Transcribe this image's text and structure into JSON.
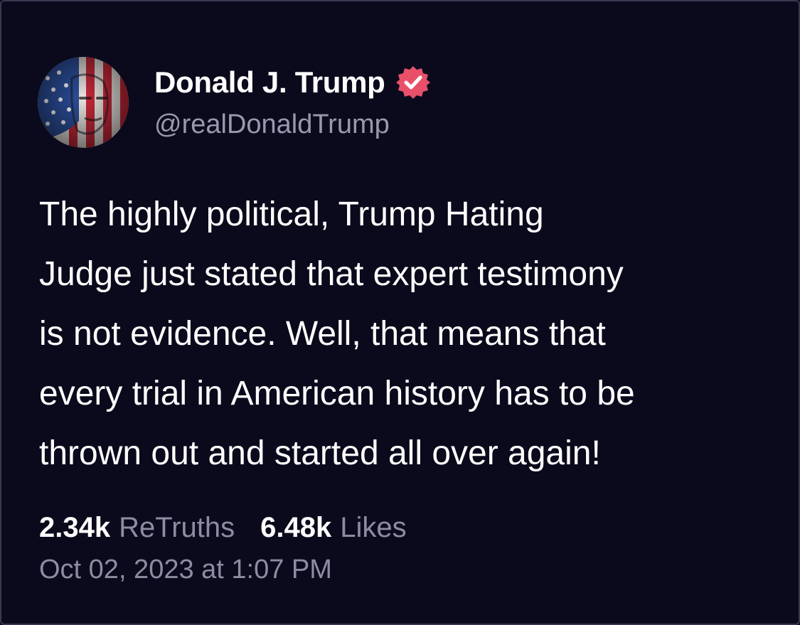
{
  "post": {
    "author": {
      "display_name": "Donald J. Trump",
      "handle": "@realDonaldTrump",
      "verified": true,
      "verified_color": "#e8506a",
      "avatar_icon": "flag-portrait-avatar"
    },
    "text_lines": [
      "The highly political, Trump Hating",
      "Judge just stated that expert testimony",
      "is not evidence. Well, that means that",
      "every trial in American history has to be",
      "thrown out and started all over again!"
    ],
    "stats": {
      "retruths_count": "2.34k",
      "retruths_label": "ReTruths",
      "likes_count": "6.48k",
      "likes_label": "Likes"
    },
    "timestamp": "Oct 02, 2023 at 1:07 PM"
  },
  "colors": {
    "background": "#0b0a1c",
    "primary_text": "#ffffff",
    "secondary_text": "#8e8ca3",
    "border": "#3a3852"
  }
}
